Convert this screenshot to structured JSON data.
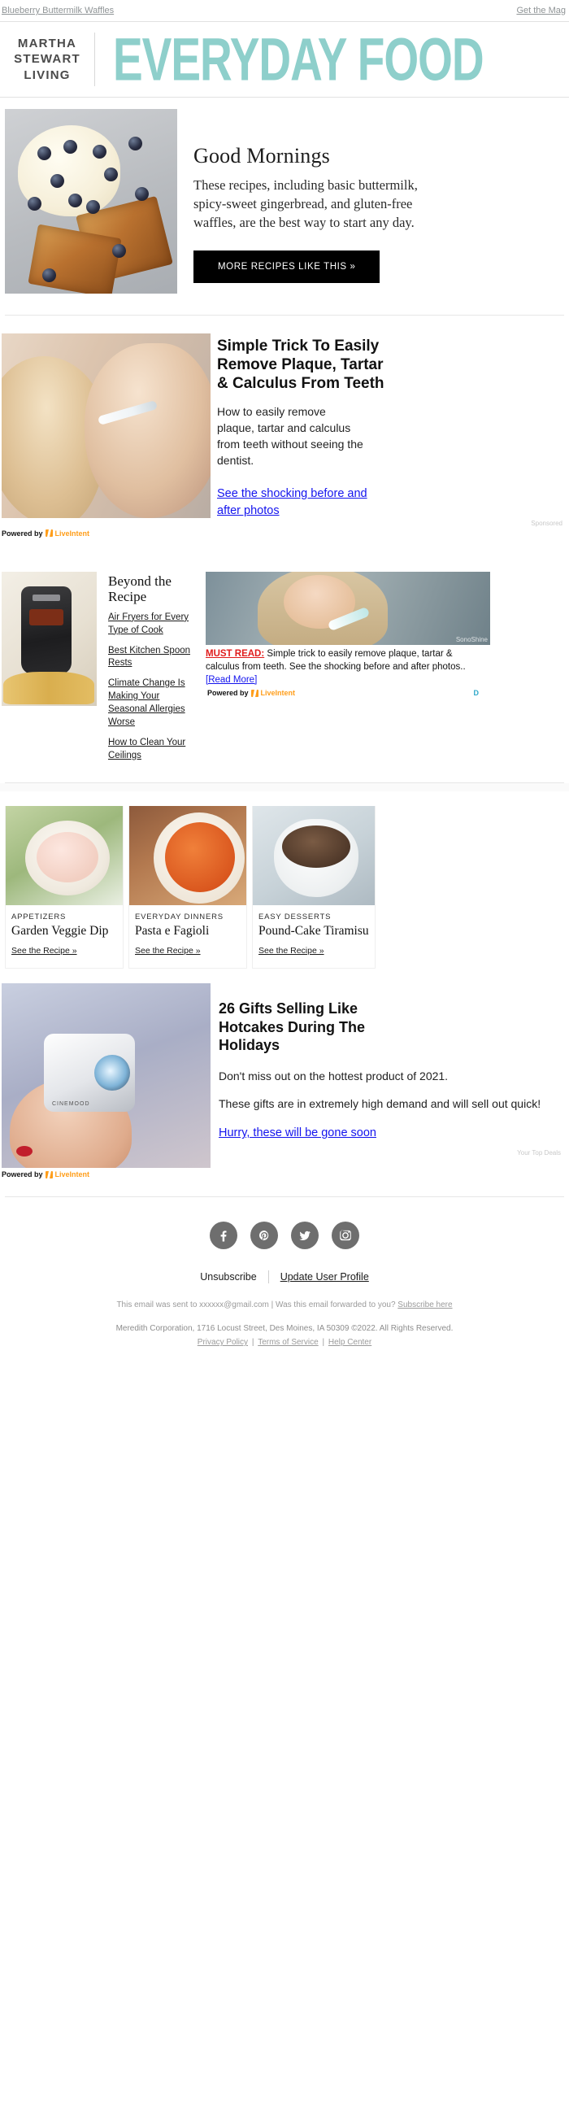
{
  "preheader": {
    "left_link": "Blueberry Buttermilk Waffles",
    "right_link": "Get the Mag"
  },
  "masthead": {
    "brand_line1": "MARTHA",
    "brand_line2": "STEWART",
    "brand_line3": "LIVING",
    "logo_text": "EVERYDAY FOOD",
    "logo_color": "#8ecfcb"
  },
  "hero": {
    "title": "Good Mornings",
    "body": [
      "These recipes, including basic buttermilk,",
      "spicy-sweet gingerbread, and gluten-free",
      "waffles, are the best way to start any day."
    ],
    "button_label": "MORE RECIPES LIKE THIS »",
    "image_alt": "blueberry-waffles-photo"
  },
  "ad1": {
    "title": [
      "Simple Trick To Easily",
      "Remove Plaque, Tartar",
      "& Calculus From Teeth"
    ],
    "body": [
      "How to easily remove",
      "plaque, tartar and calculus",
      "from teeth without seeing the",
      "dentist."
    ],
    "link": [
      "See the shocking before and",
      "after photos"
    ],
    "powered_by": "Powered by",
    "brand": "LiveIntent",
    "corner": "Sponsored"
  },
  "beyond": {
    "title": [
      "Beyond the",
      "Recipe"
    ],
    "links": [
      "Air Fryers for Every Type of Cook",
      "Best Kitchen Spoon Rests",
      "Climate Change Is Making Your Seasonal Allergies Worse",
      "How to Clean Your Ceilings"
    ],
    "ad": {
      "watermark": "SonoShine",
      "label": "MUST READ:",
      "text": " Simple trick to easily remove plaque, tartar & calculus from teeth. See the shocking before and after photos.. ",
      "readmore": "[Read More]",
      "powered_by": "Powered by",
      "brand": "LiveIntent",
      "corner": "D"
    }
  },
  "cards": [
    {
      "eyebrow": "APPETIZERS",
      "title": "Garden Veggie Dip",
      "link": "See the Recipe »",
      "image_alt": "veggie-dip-photo"
    },
    {
      "eyebrow": "EVERYDAY DINNERS",
      "title": "Pasta e Fagioli",
      "link": "See the Recipe »",
      "image_alt": "pasta-e-fagioli-photo"
    },
    {
      "eyebrow": "EASY DESSERTS",
      "title": "Pound-Cake Tiramisu",
      "link": "See the Recipe »",
      "image_alt": "tiramisu-photo"
    }
  ],
  "ad2": {
    "title": [
      "26 Gifts Selling Like",
      "Hotcakes During The",
      "Holidays"
    ],
    "body": [
      "Don't miss out on the hottest product of 2021.",
      "These gifts are in extremely high demand and will sell out quick!"
    ],
    "link": "Hurry, these will be gone soon",
    "brand_on_device": "CINEMOOD",
    "powered_by": "Powered by",
    "brand": "LiveIntent",
    "corner": "Your Top Deals"
  },
  "social": [
    {
      "name": "facebook",
      "glyph": "f"
    },
    {
      "name": "pinterest",
      "glyph": "P"
    },
    {
      "name": "twitter",
      "glyph": "t"
    },
    {
      "name": "instagram",
      "glyph": "i"
    }
  ],
  "footer": {
    "unsubscribe": "Unsubscribe",
    "update_profile": "Update User Profile",
    "sent_to_prefix": "This email was sent to xxxxxx@gmail.com  |  Was this email forwarded to you? ",
    "subscribe_here": "Subscribe here",
    "corporate": "Meredith Corporation, 1716 Locust Street, Des Moines, IA 50309 ©2022. All Rights Reserved.",
    "privacy": "Privacy Policy",
    "terms": "Terms of Service",
    "help": "Help Center",
    "sep": "|"
  }
}
